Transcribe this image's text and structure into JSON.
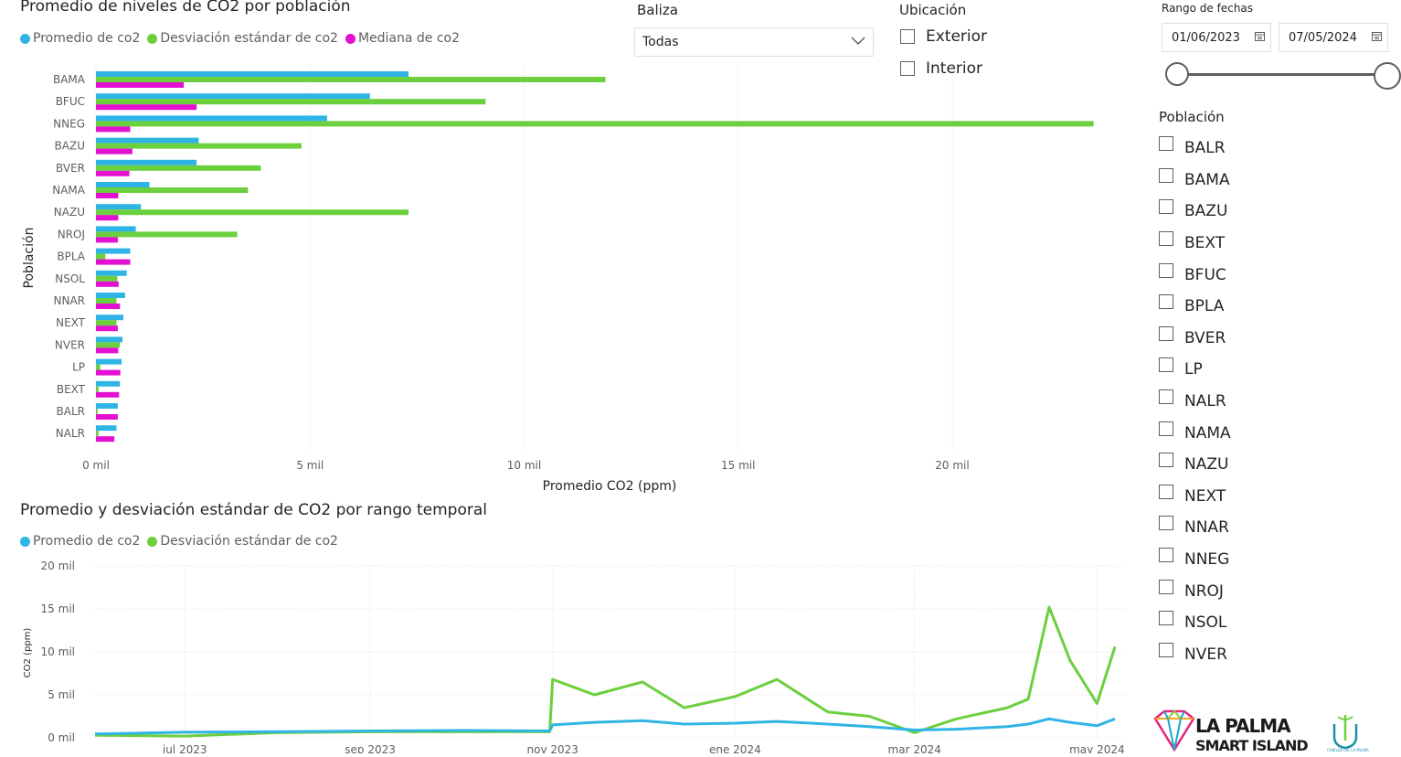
{
  "bar_chart": {
    "title": "Promedio de niveles de CO2 por población",
    "legend": [
      {
        "label": "Promedio de co2",
        "color": "#2fb5e5"
      },
      {
        "label": "Desviación estándar de co2",
        "color": "#6ccf3d"
      },
      {
        "label": "Mediana de co2",
        "color": "#e30fd1"
      }
    ],
    "ylabel": "Población",
    "xlabel": "Promedio CO2 (ppm)",
    "xtick_labels": [
      "0 mil",
      "5 mil",
      "10 mil",
      "15 mil",
      "20 mil"
    ]
  },
  "line_chart": {
    "title": "Promedio y desviación estándar de CO2 por rango temporal",
    "legend": [
      {
        "label": "Promedio de co2",
        "color": "#2fb5e5"
      },
      {
        "label": "Desviación estándar de co2",
        "color": "#6ccf3d"
      }
    ],
    "ylabel": "CO2 (ppm)",
    "ytick_labels": [
      "0 mil",
      "5 mil",
      "10 mil",
      "15 mil",
      "20 mil"
    ],
    "xtick_labels": [
      "jul 2023",
      "sep 2023",
      "nov 2023",
      "ene 2024",
      "mar 2024",
      "may 2024"
    ]
  },
  "baliza": {
    "title": "Baliza",
    "value": "Todas"
  },
  "ubicacion": {
    "title": "Ubicación",
    "options": [
      "Exterior",
      "Interior"
    ]
  },
  "fechas": {
    "title": "Rango de fechas",
    "start": "01/06/2023",
    "end": "07/05/2024"
  },
  "poblacion": {
    "title": "Población",
    "options": [
      "BALR",
      "BAMA",
      "BAZU",
      "BEXT",
      "BFUC",
      "BPLA",
      "BVER",
      "LP",
      "NALR",
      "NAMA",
      "NAZU",
      "NEXT",
      "NNAR",
      "NNEG",
      "NROJ",
      "NSOL",
      "NVER"
    ]
  },
  "logo": {
    "line1": "LA PALMA",
    "line2": "SMART ISLAND",
    "cabildo": "CABILDO DE LA PALMA"
  },
  "chart_data": [
    {
      "type": "bar",
      "title": "Promedio de niveles de CO2 por población",
      "xlabel": "Promedio CO2 (ppm)",
      "ylabel": "Población",
      "xlim": [
        0,
        24000
      ],
      "grid": true,
      "legend_position": "top-left",
      "orientation": "horizontal",
      "categories": [
        "BAMA",
        "BFUC",
        "NNEG",
        "BAZU",
        "BVER",
        "NAMA",
        "NAZU",
        "NROJ",
        "BPLA",
        "NSOL",
        "NNAR",
        "NEXT",
        "NVER",
        "LP",
        "BEXT",
        "BALR",
        "NALR"
      ],
      "series": [
        {
          "name": "Promedio de co2",
          "color": "#2fb5e5",
          "values": [
            7300,
            6400,
            5400,
            2400,
            2350,
            1250,
            1050,
            930,
            800,
            720,
            680,
            640,
            620,
            600,
            560,
            510,
            480
          ]
        },
        {
          "name": "Desviación estándar de co2",
          "color": "#6ccf3d",
          "values": [
            11900,
            9100,
            23300,
            4800,
            3850,
            3550,
            7300,
            3300,
            220,
            500,
            480,
            480,
            560,
            100,
            60,
            40,
            60
          ]
        },
        {
          "name": "Mediana de co2",
          "color": "#e30fd1",
          "values": [
            2050,
            2350,
            800,
            850,
            780,
            520,
            520,
            510,
            800,
            530,
            560,
            510,
            520,
            570,
            540,
            510,
            430
          ]
        }
      ]
    },
    {
      "type": "line",
      "title": "Promedio y desviación estándar de CO2 por rango temporal",
      "ylabel": "CO2 (ppm)",
      "ylim": [
        0,
        20000
      ],
      "grid": true,
      "legend_position": "top-left",
      "x": [
        "2023-06-01",
        "2023-07-01",
        "2023-08-01",
        "2023-09-01",
        "2023-10-01",
        "2023-10-31",
        "2023-11-01",
        "2023-11-15",
        "2023-12-01",
        "2023-12-15",
        "2024-01-01",
        "2024-01-15",
        "2024-02-01",
        "2024-02-15",
        "2024-03-01",
        "2024-03-15",
        "2024-04-01",
        "2024-04-08",
        "2024-04-15",
        "2024-04-22",
        "2024-05-01",
        "2024-05-07"
      ],
      "series": [
        {
          "name": "Promedio de co2",
          "color": "#2fb5e5",
          "values": [
            450,
            650,
            700,
            800,
            850,
            800,
            1500,
            1800,
            2000,
            1600,
            1700,
            1900,
            1600,
            1300,
            900,
            1000,
            1300,
            1600,
            2200,
            1800,
            1400,
            2200
          ]
        },
        {
          "name": "Desviación estándar de co2",
          "color": "#6ccf3d",
          "values": [
            300,
            200,
            600,
            700,
            700,
            700,
            6800,
            5000,
            6500,
            3500,
            4800,
            6800,
            3000,
            2500,
            600,
            2200,
            3500,
            4500,
            15200,
            9000,
            4000,
            10600
          ]
        }
      ]
    }
  ]
}
